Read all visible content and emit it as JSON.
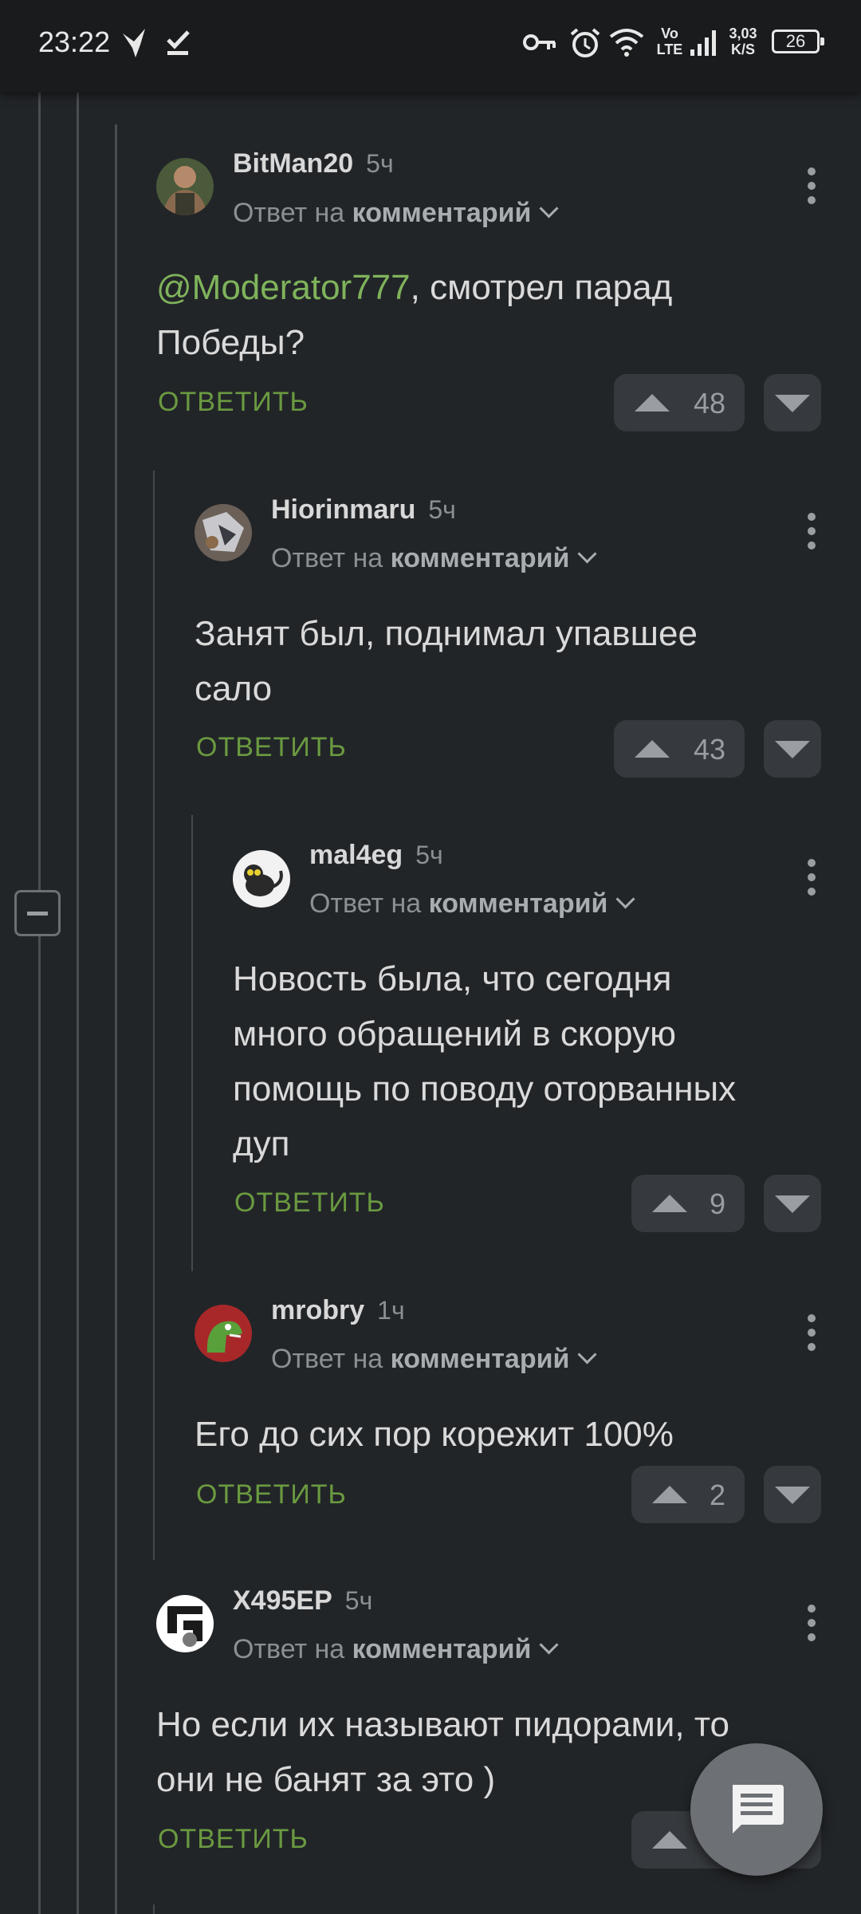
{
  "status_bar": {
    "time": "23:22",
    "lte_top": "Vo",
    "lte_bottom": "LTE",
    "speed_value": "3,03",
    "speed_unit": "K/S",
    "battery": "26",
    "icons": [
      "bird-icon",
      "check-icon",
      "key-icon",
      "alarm-icon",
      "wifi-icon",
      "signal-icon",
      "battery-icon"
    ]
  },
  "labels": {
    "reply_prefix": "Ответ на",
    "reply_target": "комментарий",
    "reply_action": "ОТВЕТИТЬ"
  },
  "comments": [
    {
      "author": "BitMan20",
      "time": "5ч",
      "mention": "@Moderator777",
      "text_line1": ", смотрел парад",
      "text_line2": "Победы?",
      "votes": "48"
    },
    {
      "author": "Hiorinmaru",
      "time": "5ч",
      "text_line1": "Занят был, поднимал упавшее",
      "text_line2": "сало",
      "votes": "43"
    },
    {
      "author": "mal4eg",
      "time": "5ч",
      "text_line1": "Новость была, что сегодня",
      "text_line2": "много обращений в скорую",
      "text_line3": "помощь по поводу оторванных",
      "text_line4": "дуп",
      "votes": "9"
    },
    {
      "author": "mrobry",
      "time": "1ч",
      "text_line1": "Его до сих пор корежит 100%",
      "votes": "2"
    },
    {
      "author": "X495EP",
      "time": "5ч",
      "text_line1": "Но если их называют пидорами, то",
      "text_line2": "они не банят за это )",
      "votes": ""
    }
  ],
  "colors": {
    "background": "#222528",
    "accent_green": "#6a9a40",
    "mention_green": "#7fb35b"
  }
}
